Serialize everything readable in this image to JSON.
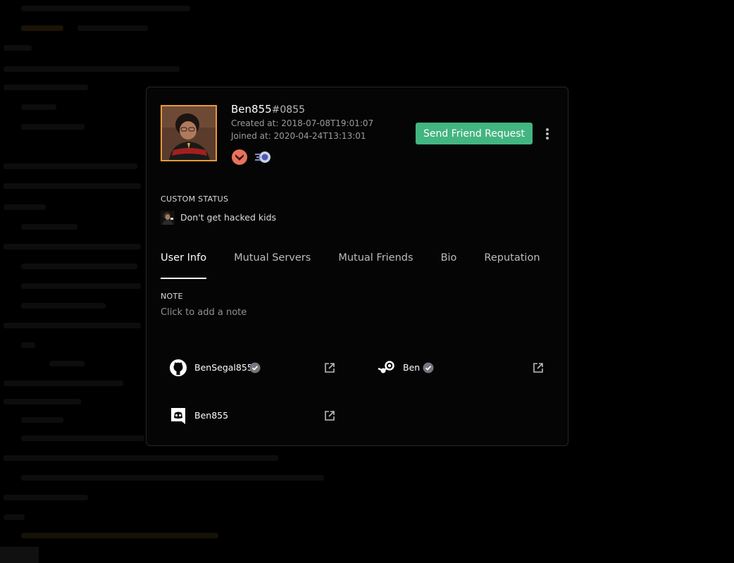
{
  "profile": {
    "username": "Ben855",
    "discriminator": "#0855",
    "created_at": "Created at: 2018-07-08T19:01:07",
    "joined_at": "Joined at: 2020-04-24T13:13:01",
    "badges": [
      "hypesquad-bravery-icon",
      "nitro-boost-icon"
    ],
    "accent_color": "#e59a3b"
  },
  "actions": {
    "send_friend_request": "Send Friend Request",
    "button_color": "#43b581"
  },
  "custom_status": {
    "title": "CUSTOM STATUS",
    "text": "Don't get hacked kids"
  },
  "tabs": [
    {
      "label": "User Info",
      "active": true
    },
    {
      "label": "Mutual Servers",
      "active": false
    },
    {
      "label": "Mutual Friends",
      "active": false
    },
    {
      "label": "Bio",
      "active": false
    },
    {
      "label": "Reputation",
      "active": false
    }
  ],
  "note": {
    "title": "NOTE",
    "placeholder": "Click to add a note"
  },
  "connections": [
    {
      "service": "github",
      "name": "BenSegal855",
      "verified": true
    },
    {
      "service": "steam",
      "name": "Ben",
      "verified": true
    },
    {
      "service": "discord",
      "name": "Ben855",
      "verified": false
    }
  ]
}
